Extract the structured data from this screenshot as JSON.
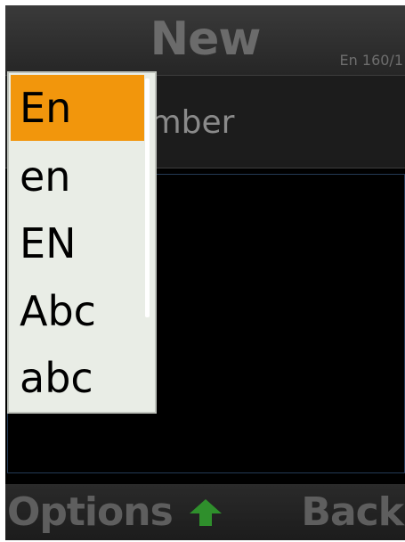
{
  "header": {
    "title": "New",
    "counter": "En 160/1"
  },
  "to_field": {
    "placeholder": "me or number"
  },
  "input_mode_menu": {
    "selected_index": 0,
    "items": [
      {
        "label": "En"
      },
      {
        "label": "en"
      },
      {
        "label": "EN"
      },
      {
        "label": "Abc"
      },
      {
        "label": "abc"
      }
    ]
  },
  "softkeys": {
    "left": "Options",
    "center_icon": "arrow-up-icon",
    "right": "Back"
  },
  "colors": {
    "selection": "#f2960c",
    "menu_background": "#e9ede6",
    "center_arrow": "#2f8f2c"
  }
}
